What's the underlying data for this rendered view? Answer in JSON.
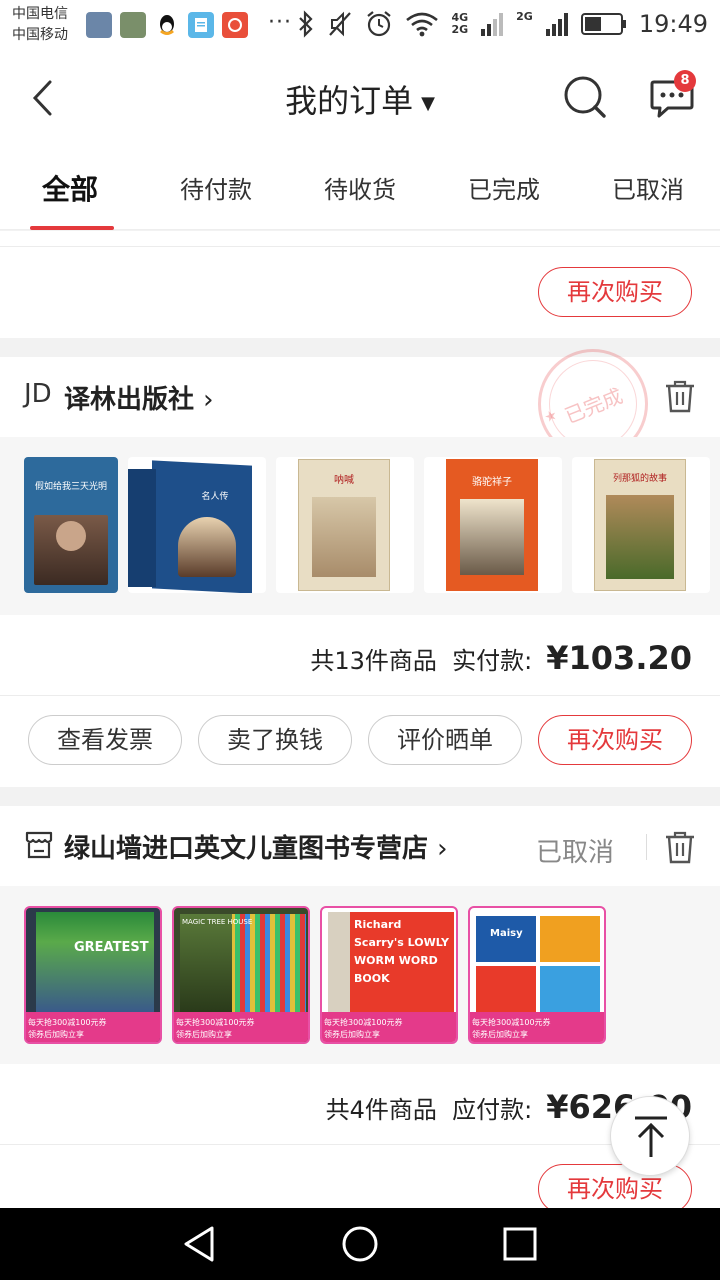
{
  "status_bar": {
    "carrier1": "中国电信",
    "carrier2": "中国移动",
    "more": "···",
    "net1": "4G",
    "net2": "2G",
    "net3": "2G",
    "time": "19:49"
  },
  "header": {
    "title": "我的订单",
    "message_badge": "8"
  },
  "tabs": [
    {
      "label": "全部",
      "active": true
    },
    {
      "label": "待付款",
      "active": false
    },
    {
      "label": "待收货",
      "active": false
    },
    {
      "label": "已完成",
      "active": false
    },
    {
      "label": "已取消",
      "active": false
    }
  ],
  "order0": {
    "rebuy": "再次购买"
  },
  "order1": {
    "shop_logo": "JD",
    "shop": "译林出版社",
    "stamp": "已完成",
    "books": [
      "假如给我三天光明",
      "名人传",
      "呐喊",
      "骆驼祥子",
      "列那狐的故事"
    ],
    "summary_count": "共13件商品",
    "summary_label": "实付款:",
    "amount": "¥103.20",
    "buttons": [
      "查看发票",
      "卖了换钱",
      "评价晒单",
      "再次购买"
    ]
  },
  "order2": {
    "shop": "绿山墙进口英文儿童图书专营店",
    "status": "已取消",
    "books": [
      {
        "title": "GREATEST",
        "promo1": "每天抢300减100元券",
        "promo2": "领券后加购立享"
      },
      {
        "title": "MAGIC TREE HOUSE",
        "promo1": "每天抢300减100元券",
        "promo2": "领券后加购立享"
      },
      {
        "title": "Richard Scarry's LOWLY WORM WORD BOOK",
        "promo1": "每天抢300减100元券",
        "promo2": "领券后加购立享"
      },
      {
        "title": "Maisy",
        "promo1": "每天抢300减100元券",
        "promo2": "领券后加购立享"
      }
    ],
    "summary_count": "共4件商品",
    "summary_label": "应付款:",
    "amount": "¥626.00",
    "rebuy": "再次购买"
  },
  "colors": {
    "accent": "#e4393c"
  }
}
